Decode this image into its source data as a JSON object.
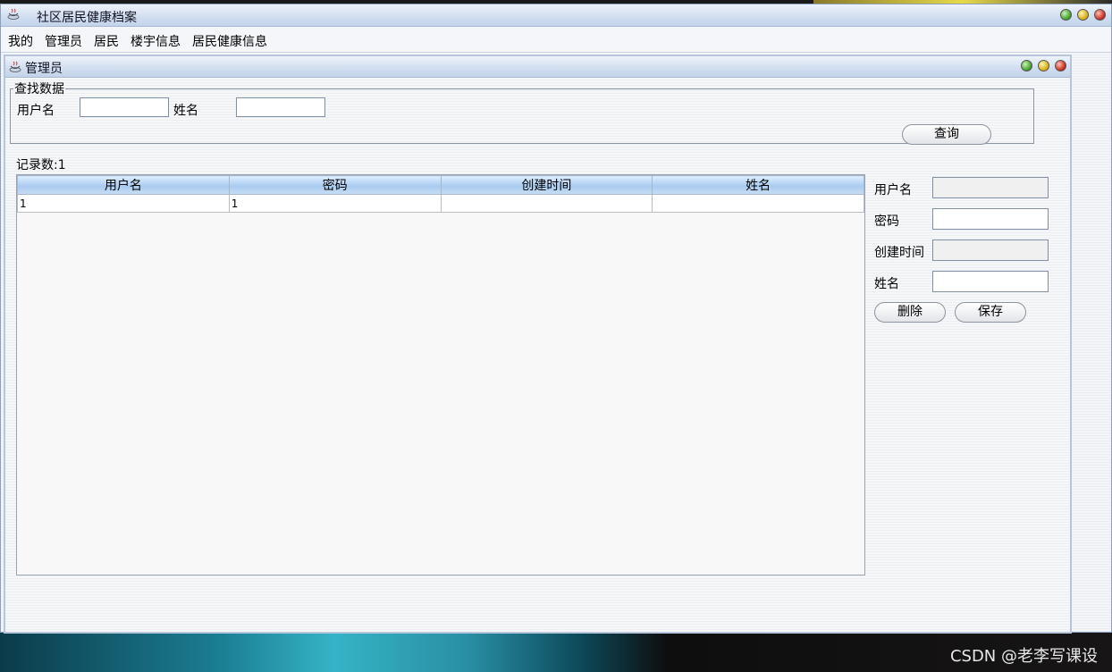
{
  "window": {
    "title": "社区居民健康档案"
  },
  "menu": [
    "我的",
    "管理员",
    "居民",
    "楼宇信息",
    "居民健康信息"
  ],
  "frame": {
    "title": "管理员"
  },
  "search": {
    "group_label": "查找数据",
    "username_label": "用户名",
    "username_value": "",
    "name_label": "姓名",
    "name_value": "",
    "query_button": "查询"
  },
  "record_count": "记录数:1",
  "table": {
    "headers": [
      "用户名",
      "密码",
      "创建时间",
      "姓名"
    ],
    "rows": [
      [
        "1",
        "1",
        "",
        ""
      ]
    ]
  },
  "form": {
    "username_label": "用户名",
    "username_value": "",
    "password_label": "密码",
    "password_value": "",
    "created_label": "创建时间",
    "created_value": "",
    "name_label": "姓名",
    "name_value": "",
    "delete_button": "删除",
    "save_button": "保存"
  },
  "watermark": "CSDN @老李写课设"
}
